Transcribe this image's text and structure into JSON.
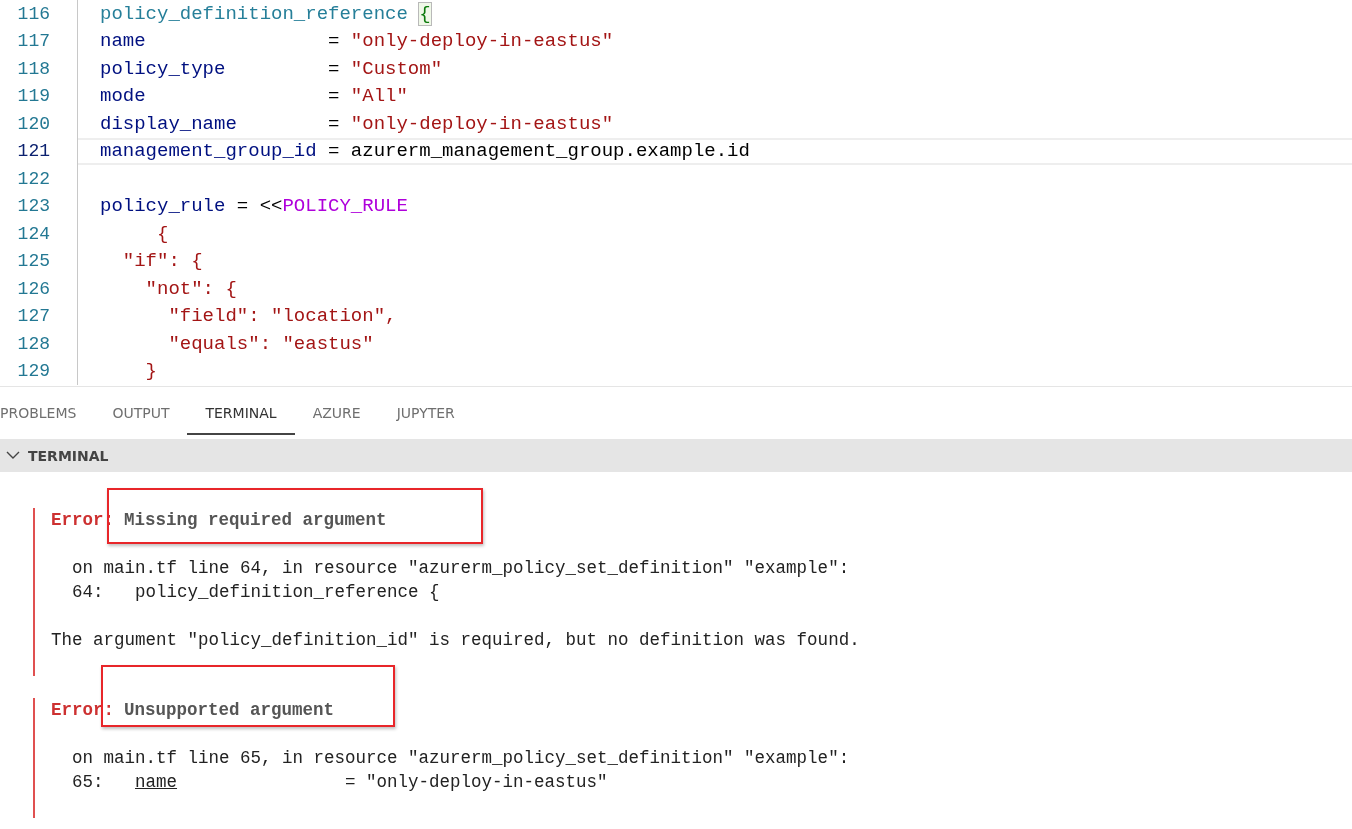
{
  "editor": {
    "lines": [
      {
        "number": "116",
        "current": false,
        "tokens": [
          {
            "text": "policy_definition_reference ",
            "kind": "block"
          },
          {
            "text": "{",
            "kind": "bracket"
          }
        ]
      },
      {
        "number": "117",
        "current": false,
        "tokens": [
          {
            "text": "name                ",
            "kind": "property"
          },
          {
            "text": "= ",
            "kind": "plain"
          },
          {
            "text": "\"only-deploy-in-eastus\"",
            "kind": "string"
          }
        ]
      },
      {
        "number": "118",
        "current": false,
        "tokens": [
          {
            "text": "policy_type         ",
            "kind": "property"
          },
          {
            "text": "= ",
            "kind": "plain"
          },
          {
            "text": "\"Custom\"",
            "kind": "string"
          }
        ]
      },
      {
        "number": "119",
        "current": false,
        "tokens": [
          {
            "text": "mode                ",
            "kind": "property"
          },
          {
            "text": "= ",
            "kind": "plain"
          },
          {
            "text": "\"All\"",
            "kind": "string"
          }
        ]
      },
      {
        "number": "120",
        "current": false,
        "tokens": [
          {
            "text": "display_name        ",
            "kind": "property"
          },
          {
            "text": "= ",
            "kind": "plain"
          },
          {
            "text": "\"only-deploy-in-eastus\"",
            "kind": "string"
          }
        ]
      },
      {
        "number": "121",
        "current": true,
        "tokens": [
          {
            "text": "management_group_id ",
            "kind": "property"
          },
          {
            "text": "= azurerm_management_group.example.id",
            "kind": "plain"
          }
        ]
      },
      {
        "number": "122",
        "current": false
      },
      {
        "number": "123",
        "current": false,
        "tokens": [
          {
            "text": "policy_rule ",
            "kind": "property"
          },
          {
            "text": "= <<",
            "kind": "plain"
          },
          {
            "text": "POLICY_RULE",
            "kind": "marker"
          }
        ]
      },
      {
        "number": "124",
        "current": false,
        "tokens": [
          {
            "text": "     {",
            "kind": "string"
          }
        ]
      },
      {
        "number": "125",
        "current": false,
        "tokens": [
          {
            "text": "  \"if\": {",
            "kind": "string"
          }
        ]
      },
      {
        "number": "126",
        "current": false,
        "tokens": [
          {
            "text": "    \"not\": {",
            "kind": "string"
          }
        ]
      },
      {
        "number": "127",
        "current": false,
        "tokens": [
          {
            "text": "      \"field\": \"location\",",
            "kind": "string"
          }
        ]
      },
      {
        "number": "128",
        "current": false,
        "tokens": [
          {
            "text": "      \"equals\": \"eastus\"",
            "kind": "string"
          }
        ]
      },
      {
        "number": "129",
        "current": false,
        "tokens": [
          {
            "text": "    }",
            "kind": "string"
          }
        ]
      }
    ]
  },
  "panel_tabs": [
    {
      "label": "PROBLEMS",
      "selected": false
    },
    {
      "label": "OUTPUT",
      "selected": false
    },
    {
      "label": "TERMINAL",
      "selected": true
    },
    {
      "label": "AZURE",
      "selected": false
    },
    {
      "label": "JUPYTER",
      "selected": false
    }
  ],
  "section": {
    "title": "TERMINAL",
    "expanded": true
  },
  "errors": [
    {
      "label": "Error:",
      "title": "Missing required argument",
      "highlighted": true,
      "location": "  on main.tf line 64, in resource \"azurerm_policy_set_definition\" \"example\":",
      "source": [
        {
          "text": "  64:   ",
          "underlined": false
        },
        {
          "text": "policy_definition_reference {",
          "underlined": false
        }
      ],
      "message": "The argument \"policy_definition_id\" is required, but no definition was found."
    },
    {
      "label": "Error:",
      "title": "Unsupported argument",
      "highlighted": true,
      "location": "  on main.tf line 65, in resource \"azurerm_policy_set_definition\" \"example\":",
      "source": [
        {
          "text": "  65:   ",
          "underlined": false
        },
        {
          "text": "name",
          "underlined": true
        },
        {
          "text": "                = \"only-deploy-in-eastus\"",
          "underlined": false
        }
      ]
    }
  ]
}
